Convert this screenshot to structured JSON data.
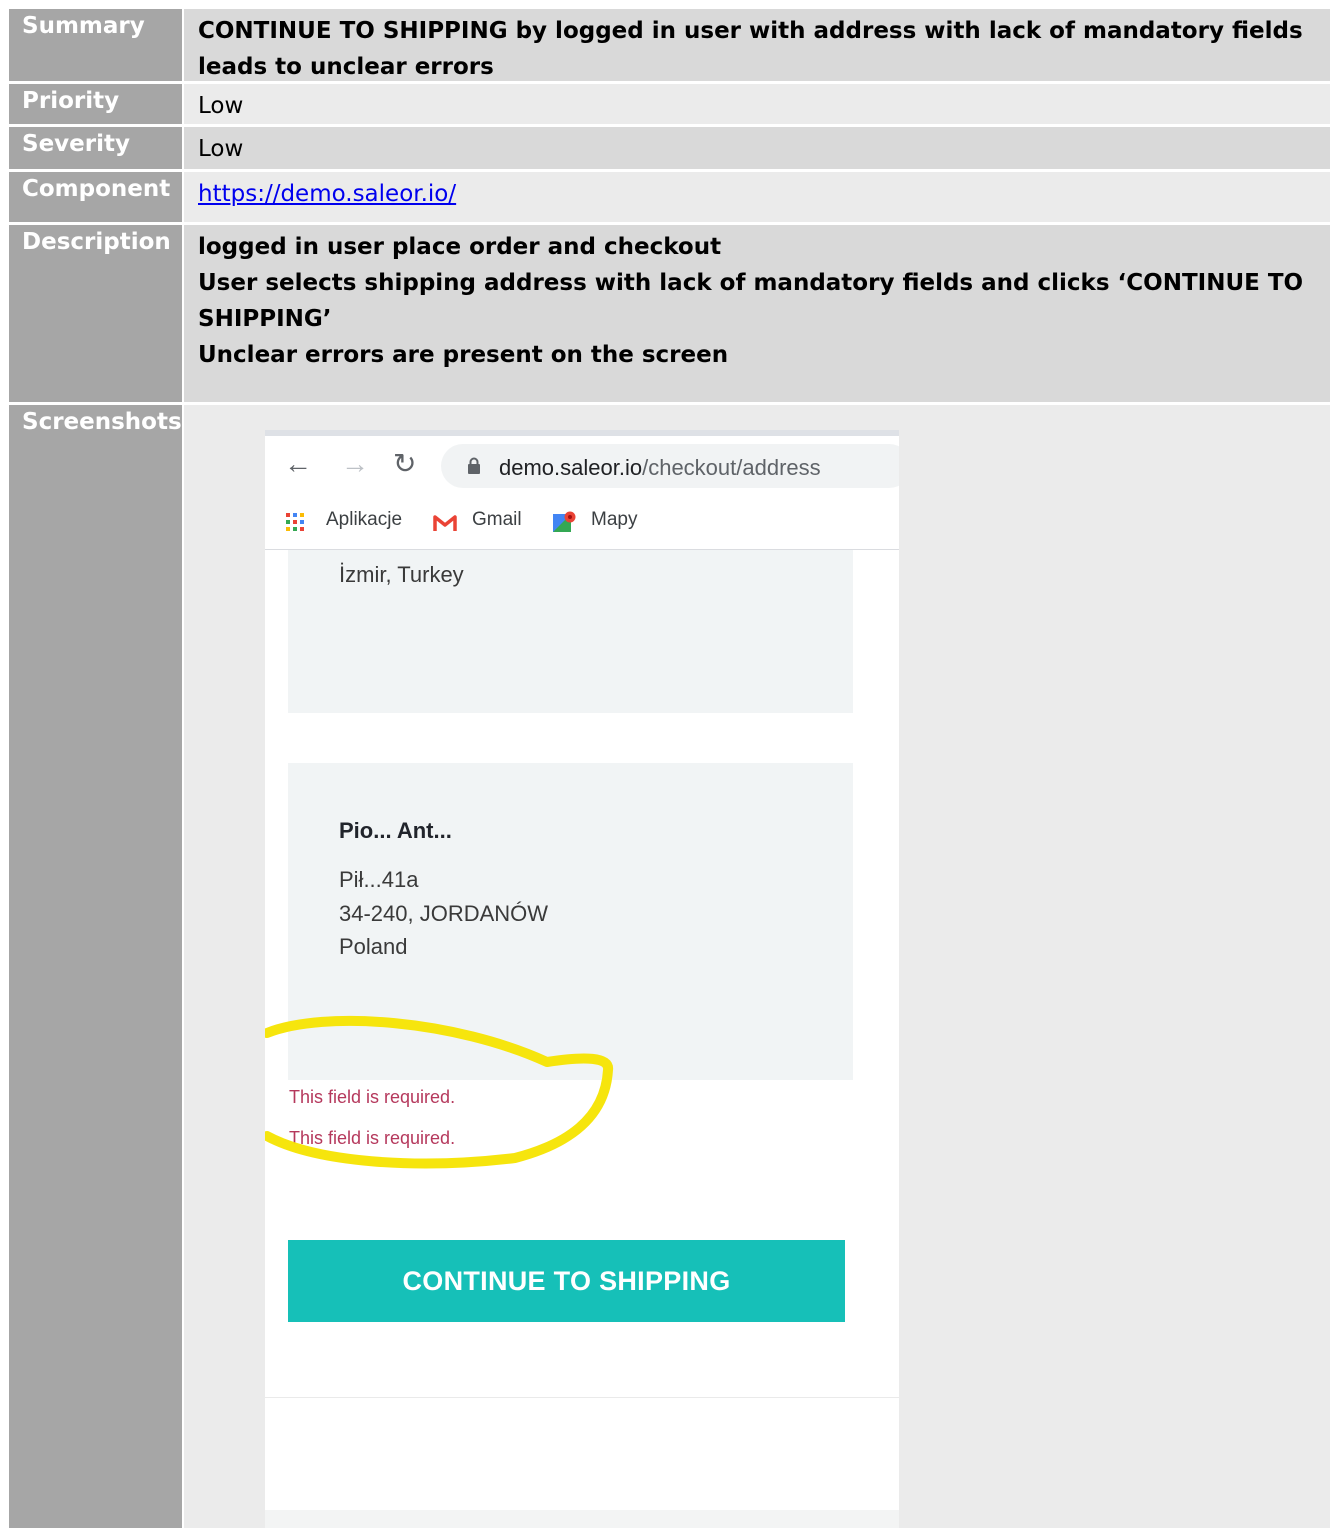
{
  "report": {
    "summary": {
      "label": "Summary",
      "value": "CONTINUE TO SHIPPING by logged in user with address with lack of mandatory fields leads to unclear errors"
    },
    "priority": {
      "label": "Priority",
      "value": "Low"
    },
    "severity": {
      "label": "Severity",
      "value": "Low"
    },
    "component": {
      "label": "Component",
      "link": "https://demo.saleor.io/"
    },
    "description": {
      "label": "Description",
      "lines": [
        "logged in user place order and checkout",
        "User selects shipping address with lack of mandatory fields and clicks ‘CONTINUE TO",
        "SHIPPING’",
        "Unclear errors are present on the screen"
      ]
    },
    "screenshots": {
      "label": "Screenshots"
    }
  },
  "screenshot": {
    "url_host": "demo.saleor.io",
    "url_path": "/checkout/address",
    "bookmarks": [
      "Aplikacje",
      "Gmail",
      "Mapy"
    ],
    "address_1_tail": "İzmir, Turkey",
    "address_2": {
      "name": "Pio... Ant...",
      "street": "Pił...41a",
      "city": "34-240, JORDANÓW",
      "country": "Poland"
    },
    "errors": [
      "This field is required.",
      "This field is required."
    ],
    "continue_button": "CONTINUE TO SHIPPING",
    "colors": {
      "button": "#16c0b8",
      "error": "#b5385c",
      "highlight": "#f5e400"
    }
  }
}
